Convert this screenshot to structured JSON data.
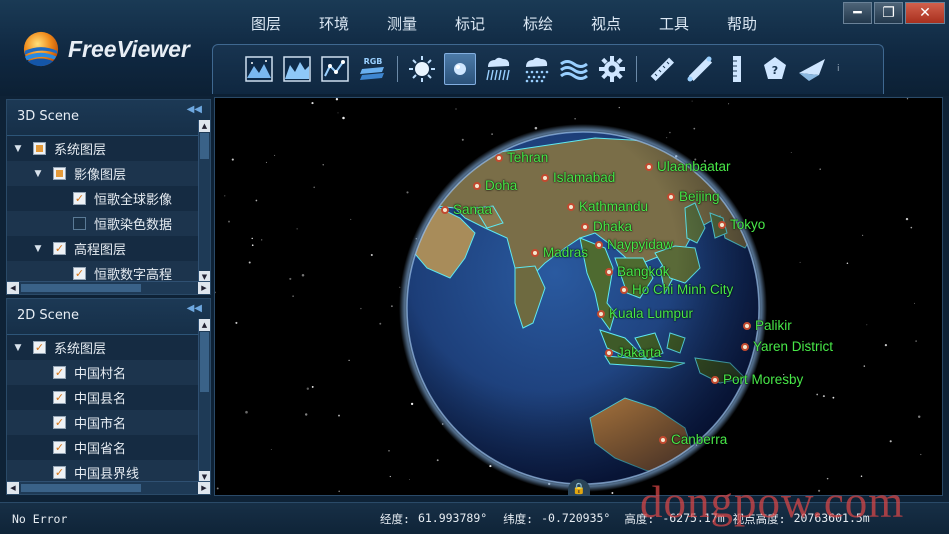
{
  "app": {
    "name": "FreeViewer"
  },
  "menu": [
    {
      "label": "图层"
    },
    {
      "label": "环境"
    },
    {
      "label": "测量"
    },
    {
      "label": "标记"
    },
    {
      "label": "标绘"
    },
    {
      "label": "视点"
    },
    {
      "label": "工具"
    },
    {
      "label": "帮助"
    }
  ],
  "window_controls": {
    "minimize": "━",
    "restore": "❐",
    "close": "✕"
  },
  "toolbar": {
    "icons": [
      "image-layer-icon",
      "terrain-layer-icon",
      "vector-layer-icon",
      "rgb-layer-icon",
      "sun-icon",
      "globe-view-icon",
      "rain-icon",
      "snow-icon",
      "water-icon",
      "settings-gear-icon",
      "distance-ruler-icon",
      "path-ruler-icon",
      "height-ruler-icon",
      "info-marker-icon",
      "fly-plane-icon"
    ],
    "rgb_label": "RGB",
    "more_label": "i",
    "active_index": 5
  },
  "scene3d": {
    "title": "3D Scene",
    "collapse": "◀◀",
    "items": [
      {
        "label": "系统图层",
        "level": 0,
        "expanded": true,
        "check": "partial"
      },
      {
        "label": "影像图层",
        "level": 1,
        "expanded": true,
        "check": "partial"
      },
      {
        "label": "恒歌全球影像",
        "level": 2,
        "check": "checked"
      },
      {
        "label": "恒歌染色数据",
        "level": 2,
        "check": "empty"
      },
      {
        "label": "高程图层",
        "level": 1,
        "expanded": true,
        "check": "checked"
      },
      {
        "label": "恒歌数字高程",
        "level": 2,
        "check": "checked"
      }
    ]
  },
  "scene2d": {
    "title": "2D Scene",
    "collapse": "◀◀",
    "items": [
      {
        "label": "系统图层",
        "level": 0,
        "expanded": true,
        "check": "checked"
      },
      {
        "label": "中国村名",
        "level": 1,
        "check": "checked"
      },
      {
        "label": "中国县名",
        "level": 1,
        "check": "checked"
      },
      {
        "label": "中国市名",
        "level": 1,
        "check": "checked"
      },
      {
        "label": "中国省名",
        "level": 1,
        "check": "checked"
      },
      {
        "label": "中国县界线",
        "level": 1,
        "check": "checked"
      }
    ]
  },
  "globe": {
    "colors": {
      "ocean": "#1f3f78",
      "land": "#6b7448",
      "label": "#48e848",
      "border": "#5ee8f0"
    },
    "cities": [
      {
        "name": "Tehran",
        "side": "right"
      },
      {
        "name": "Doha",
        "side": "right"
      },
      {
        "name": "Islamabad",
        "side": "right"
      },
      {
        "name": "Ulaanbaatar",
        "side": "right"
      },
      {
        "name": "Sanaa",
        "side": "right"
      },
      {
        "name": "Kathmandu",
        "side": "right"
      },
      {
        "name": "Beijing",
        "side": "right"
      },
      {
        "name": "Dhaka",
        "side": "right"
      },
      {
        "name": "Tokyo",
        "side": "right"
      },
      {
        "name": "Naypyidaw",
        "side": "right"
      },
      {
        "name": "Madras",
        "side": "right"
      },
      {
        "name": "Bangkok",
        "side": "right"
      },
      {
        "name": "Ho Chi Minh City",
        "side": "right"
      },
      {
        "name": "Kuala Lumpur",
        "side": "right"
      },
      {
        "name": "Palikir",
        "side": "right"
      },
      {
        "name": "Yaren District",
        "side": "right"
      },
      {
        "name": "Jakarta",
        "side": "right"
      },
      {
        "name": "Port Moresby",
        "side": "right"
      },
      {
        "name": "Canberra",
        "side": "right"
      }
    ]
  },
  "lock_icon": "🔒",
  "status": {
    "error": "No Error",
    "lon_label": "经度:",
    "lon": "61.993789°",
    "lat_label": "纬度:",
    "lat": "-0.720935°",
    "alt_label": "高度:",
    "alt": "-6275.17m",
    "view_alt_label": "视点高度:",
    "view_alt": "20763601.5m"
  },
  "watermark": "dongpow.com"
}
